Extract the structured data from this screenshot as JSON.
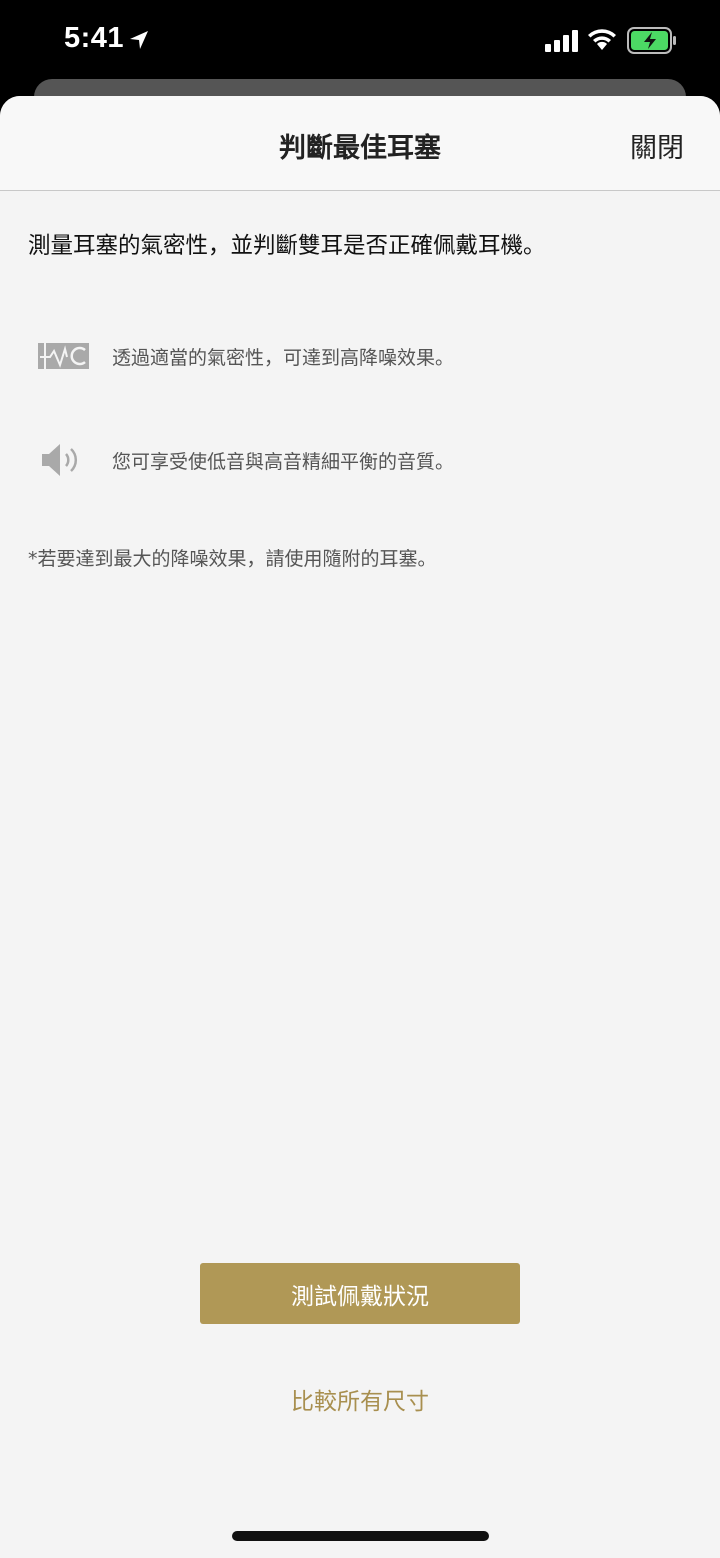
{
  "status_bar": {
    "time": "5:41",
    "icons": [
      "location-arrow-icon",
      "cellular-signal-icon",
      "wifi-icon",
      "battery-charging-icon"
    ],
    "battery_color": "#4cd964"
  },
  "header": {
    "title": "判斷最佳耳塞",
    "close_label": "關閉"
  },
  "intro": "測量耳塞的氣密性，並判斷雙耳是否正確佩戴耳機。",
  "features": [
    {
      "icon": "noise-cancelling-icon",
      "text": "透過適當的氣密性，可達到高降噪效果。"
    },
    {
      "icon": "speaker-icon",
      "text": "您可享受使低音與高音精細平衡的音質。"
    }
  ],
  "note": "*若要達到最大的降噪效果，請使用隨附的耳塞。",
  "actions": {
    "primary_label": "測試佩戴狀況",
    "secondary_label": "比較所有尺寸"
  },
  "colors": {
    "accent": "#b09856",
    "link": "#a88f4f",
    "sheet_bg": "#f4f4f4"
  }
}
